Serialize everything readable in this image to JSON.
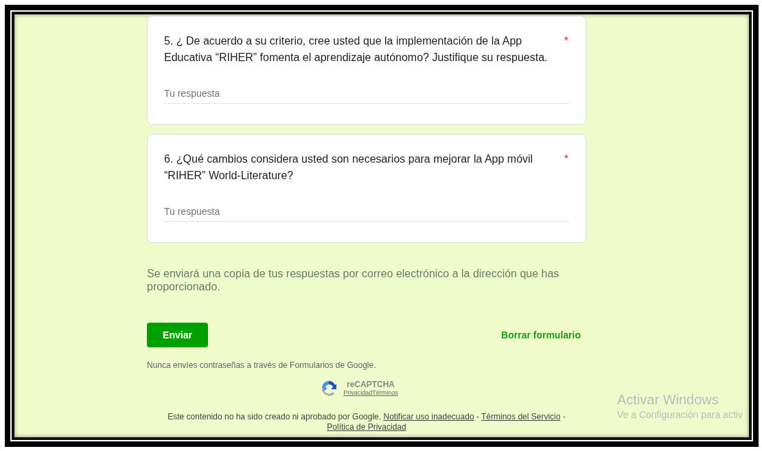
{
  "questions": [
    {
      "text": "5.  ¿ De acuerdo a su criterio, cree usted que la implementación de la App Educativa “RIHER” fomenta el aprendizaje autónomo? Justifique su respuesta.",
      "required": true,
      "required_mark": "*",
      "placeholder": "Tu respuesta"
    },
    {
      "text": "6. ¿Qué cambios considera usted son necesarios para mejorar la App móvil “RIHER” World-Literature?",
      "required": true,
      "required_mark": "*",
      "placeholder": "Tu respuesta"
    }
  ],
  "copy_notice": "Se enviará una copia de tus respuestas por correo electrónico a la dirección que has proporcionado.",
  "submit_button": "Enviar",
  "clear_link": "Borrar formulario",
  "password_warning": "Nunca envíes contraseñas a través de Formularios de Google.",
  "recaptcha": {
    "title": "reCAPTCHA",
    "links": [
      "Privacidad",
      "Términos"
    ]
  },
  "footer": {
    "text": "Este contenido no ha sido creado ni aprobado por Google.",
    "links": [
      "Notificar uso inadecuado",
      "Términos del Servicio",
      "Política de Privacidad"
    ],
    "separator": "-"
  },
  "activation_notice": {
    "title": "Activar Windows",
    "subtitle": "Ve a Configuración para activ"
  }
}
